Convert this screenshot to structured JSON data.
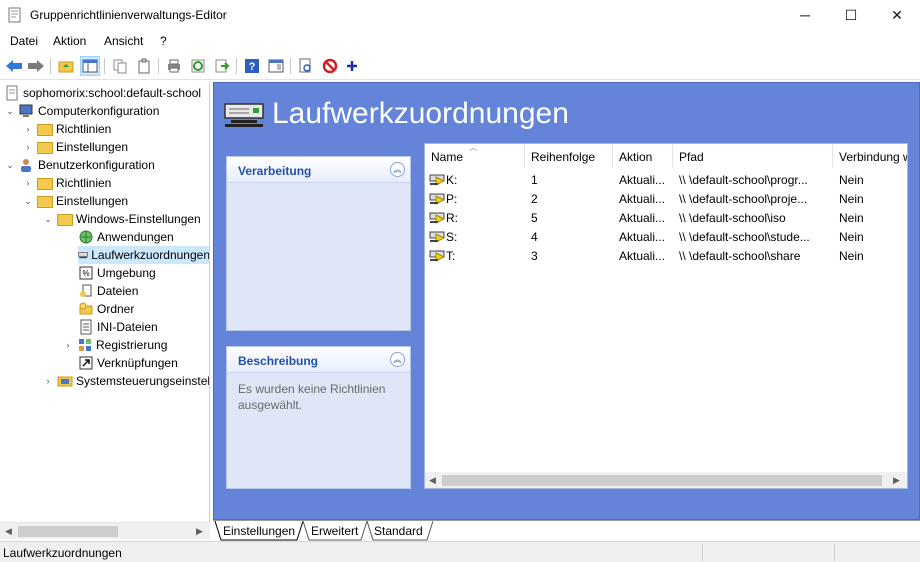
{
  "window": {
    "title": "Gruppenrichtlinienverwaltungs-Editor",
    "min_glyph": "─",
    "max_glyph": "☐",
    "close_glyph": "✕"
  },
  "menu": [
    "Datei",
    "Aktion",
    "Ansicht",
    "?"
  ],
  "tree": {
    "root": "sophomorix:school:default-school",
    "computer": "Computerkonfiguration",
    "computer_children": [
      "Richtlinien",
      "Einstellungen"
    ],
    "user": "Benutzerkonfiguration",
    "user_policies": "Richtlinien",
    "user_settings": "Einstellungen",
    "windows_settings": "Windows-Einstellungen",
    "windows_items": [
      "Anwendungen",
      "Laufwerkzuordnungen",
      "Umgebung",
      "Dateien",
      "Ordner",
      "INI-Dateien",
      "Registrierung",
      "Verknüpfungen"
    ],
    "control_panel": "Systemsteuerungseinstellungen"
  },
  "content": {
    "heading": "Laufwerkzuordnungen",
    "processing_title": "Verarbeitung",
    "description_title": "Beschreibung",
    "description_text": "Es wurden keine Richtlinien ausgewählt."
  },
  "list": {
    "columns": [
      "Name",
      "Reihenfolge",
      "Aktion",
      "Pfad",
      "Verbindung w"
    ],
    "rows": [
      {
        "name": "K:",
        "order": "1",
        "action": "Aktuali...",
        "path": "\\\\     \\default-school\\progr...",
        "conn": "Nein"
      },
      {
        "name": "P:",
        "order": "2",
        "action": "Aktuali...",
        "path": "\\\\     \\default-school\\proje...",
        "conn": "Nein"
      },
      {
        "name": "R:",
        "order": "5",
        "action": "Aktuali...",
        "path": "\\\\     \\default-school\\iso",
        "conn": "Nein"
      },
      {
        "name": "S:",
        "order": "4",
        "action": "Aktuali...",
        "path": "\\\\     \\default-school\\stude...",
        "conn": "Nein"
      },
      {
        "name": "T:",
        "order": "3",
        "action": "Aktuali...",
        "path": "\\\\     \\default-school\\share",
        "conn": "Nein"
      }
    ]
  },
  "tabs": [
    "Einstellungen",
    "Erweitert",
    "Standard"
  ],
  "status": "Laufwerkzuordnungen",
  "colors": {
    "content_bg": "#6384d8",
    "panel_title": "#2150ad",
    "selection": "#cce8ff"
  }
}
